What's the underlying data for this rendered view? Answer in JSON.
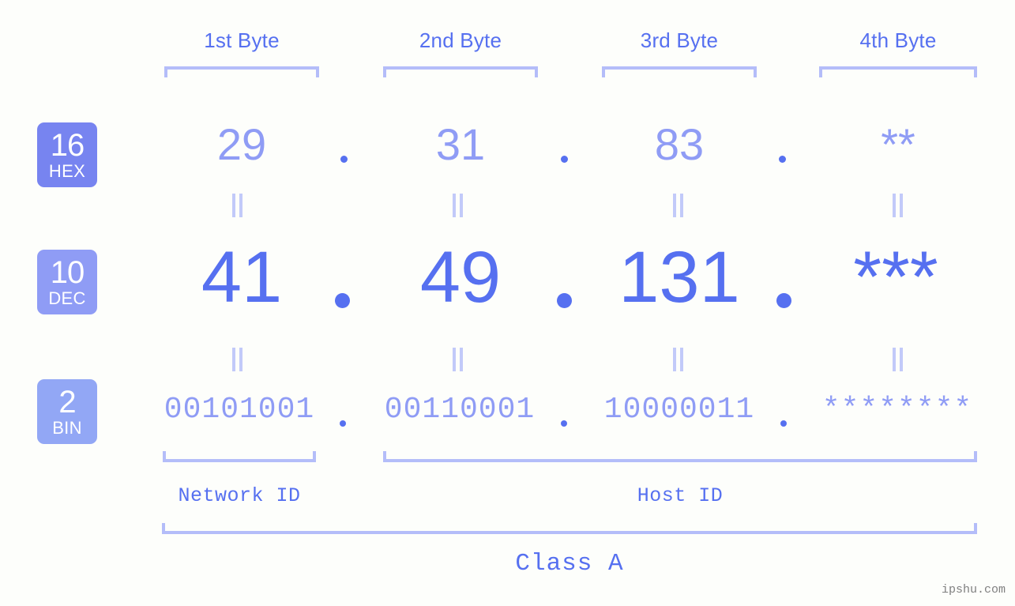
{
  "page": {
    "background_color": "#fdfefb",
    "accent_color": "#5670f0",
    "accent_light_color": "#8f9cf5",
    "bracket_color": "#b4bdf9"
  },
  "byte_headers": [
    {
      "label": "1st Byte"
    },
    {
      "label": "2nd Byte"
    },
    {
      "label": "3rd Byte"
    },
    {
      "label": "4th Byte"
    }
  ],
  "bases": [
    {
      "number": "16",
      "name": "HEX",
      "color": "#7784f0"
    },
    {
      "number": "10",
      "name": "DEC",
      "color": "#8f9cf5"
    },
    {
      "number": "2",
      "name": "BIN",
      "color": "#92a7f5"
    }
  ],
  "rows": {
    "hex": {
      "values": [
        "29",
        "31",
        "83",
        "**"
      ]
    },
    "dec": {
      "values": [
        "41",
        "49",
        "131",
        "***"
      ]
    },
    "bin": {
      "values": [
        "00101001",
        "00110001",
        "10000011",
        "********"
      ]
    }
  },
  "separator": ".",
  "equals_glyph": "=",
  "segments": {
    "network_id": "Network ID",
    "host_id": "Host ID"
  },
  "class_label": "Class A",
  "watermark": "ipshu.com"
}
